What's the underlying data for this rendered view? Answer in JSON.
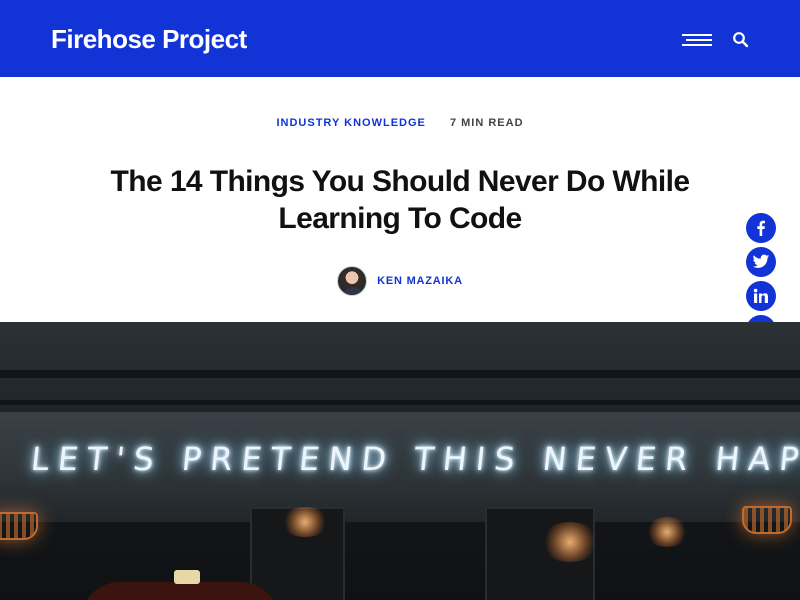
{
  "header": {
    "brand": "Firehose Project",
    "menu_icon": "hamburger-icon",
    "search_icon": "search-icon",
    "background": "#1233d6"
  },
  "article": {
    "category": "INDUSTRY KNOWLEDGE",
    "read_time": "7 MIN READ",
    "title_line1": "The 14 Things You Should Never Do While",
    "title_line2": "Learning To Code",
    "author": "KEN MAZAIKA"
  },
  "share": [
    {
      "name": "facebook-icon"
    },
    {
      "name": "twitter-icon"
    },
    {
      "name": "linkedin-icon"
    },
    {
      "name": "link-icon"
    }
  ],
  "hero": {
    "neon_text": "LET'S PRETEND THIS NEVER HAPPENED"
  },
  "colors": {
    "accent": "#1233d6",
    "text": "#111111"
  }
}
